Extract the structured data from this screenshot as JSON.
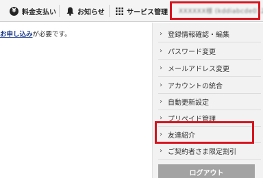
{
  "header": {
    "billing_label": "料金支払い",
    "notifications_label": "お知らせ",
    "services_label": "サービス管理",
    "user_name": "XXXXXX様 (kddiabcde0123)"
  },
  "main": {
    "notice_link": "お申し込み",
    "notice_suffix": "が必要です。"
  },
  "menu": {
    "items": [
      {
        "label": "登録情報確認・編集"
      },
      {
        "label": "パスワード変更"
      },
      {
        "label": "メールアドレス変更"
      },
      {
        "label": "アカウントの統合"
      },
      {
        "label": "自動更新設定"
      },
      {
        "label": "プリペイド管理"
      },
      {
        "label": "友達紹介"
      },
      {
        "label": "ご契約者さま限定割引"
      }
    ],
    "logout_label": "ログアウト"
  },
  "colors": {
    "highlight": "#d8141e",
    "logout_bg": "#a3a3a3",
    "link": "#1a3a8a"
  }
}
